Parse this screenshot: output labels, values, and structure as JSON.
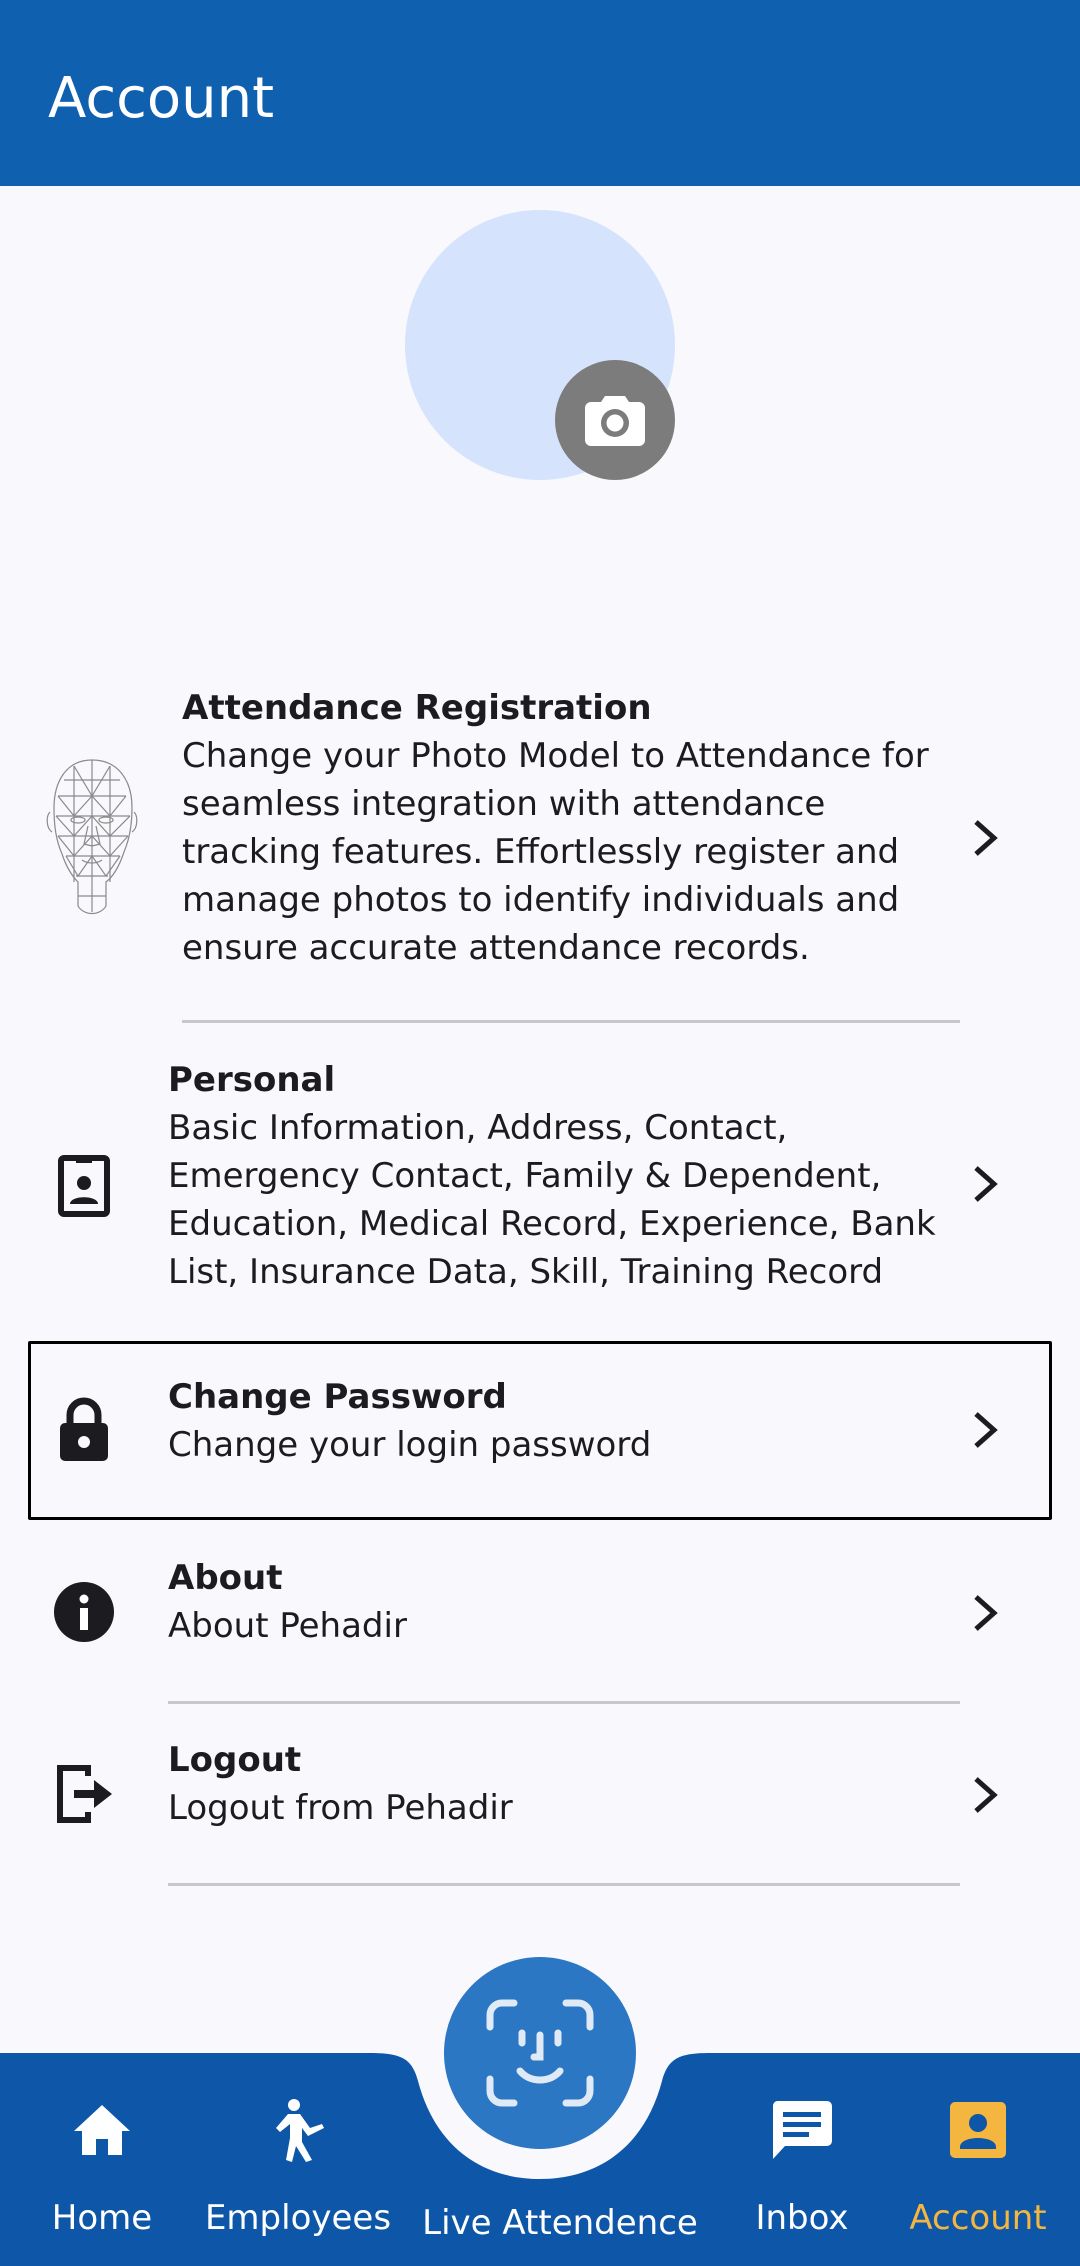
{
  "app_bar": {
    "title": "Account"
  },
  "profile": {
    "camera_icon": "camera-icon"
  },
  "menu": [
    {
      "id": "attendance",
      "icon": "face-mesh-head-icon",
      "title": "Attendance Registration",
      "lines": [
        "Change your Photo Model to Attendance for",
        "seamless integration with attendance",
        "tracking features. Effortlessly register and",
        "manage photos to identify individuals and",
        "ensure accurate attendance records."
      ]
    },
    {
      "id": "personal",
      "icon": "contact-badge-icon",
      "title": "Personal",
      "lines": [
        "Basic Information, Address, Contact,",
        "Emergency Contact, Family & Dependent,",
        "Education, Medical Record, Experience, Bank",
        "List, Insurance Data, Skill, Training Record"
      ]
    },
    {
      "id": "change-password",
      "icon": "lock-icon",
      "title": "Change Password",
      "lines": [
        "Change your login password"
      ]
    },
    {
      "id": "about",
      "icon": "info-icon",
      "title": "About",
      "lines": [
        "About Pehadir"
      ]
    },
    {
      "id": "logout",
      "icon": "logout-icon",
      "title": "Logout",
      "lines": [
        "Logout from Pehadir"
      ]
    }
  ],
  "bottom_nav": {
    "items": [
      {
        "label": "Home",
        "icon": "home-icon"
      },
      {
        "label": "Employees",
        "icon": "person-walking-icon"
      },
      {
        "label": "Live Attendence",
        "icon": "face-scan-icon"
      },
      {
        "label": "Inbox",
        "icon": "chat-message-icon"
      },
      {
        "label": "Account",
        "icon": "account-box-icon",
        "active": true
      }
    ]
  },
  "colors": {
    "primary": "#0f60ae",
    "nav_bg": "#0d56a8",
    "fab": "#2b77c3",
    "active_tab": "#f4b63f",
    "avatar_bg": "#d6e3fd"
  }
}
